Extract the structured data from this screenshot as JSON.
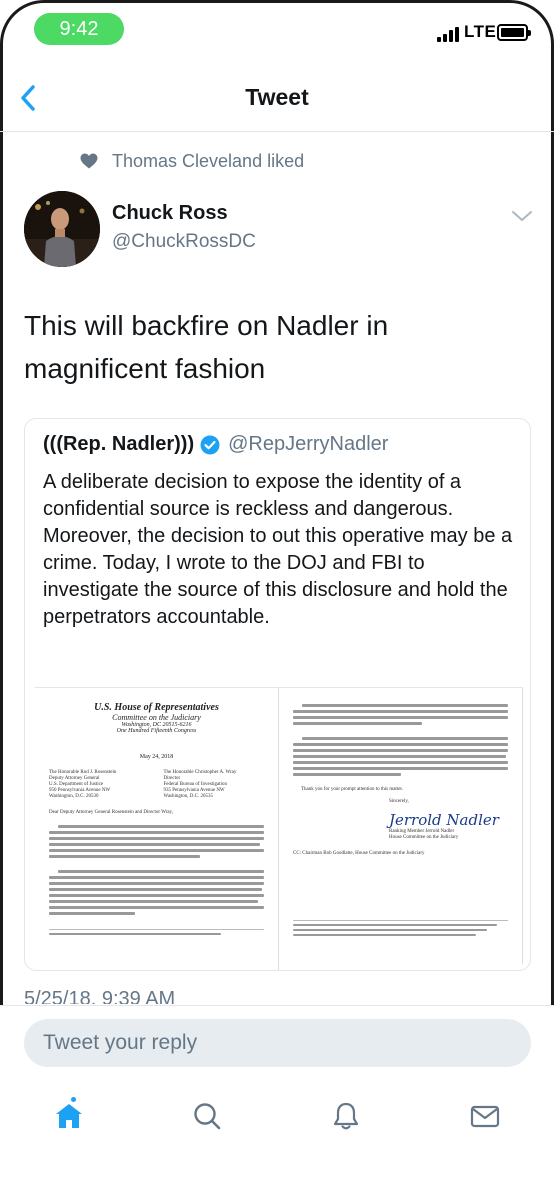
{
  "status_bar": {
    "time": "9:42",
    "network": "LTE"
  },
  "nav": {
    "title": "Tweet",
    "back_icon": "chevron-left-icon"
  },
  "social_context": {
    "icon": "heart-icon",
    "text": "Thomas Cleveland liked"
  },
  "tweet": {
    "display_name": "Chuck Ross",
    "handle": "@ChuckRossDC",
    "text": "This will backfire on Nadler in magnificent fashion",
    "timestamp": "5/25/18, 9:39 AM"
  },
  "quoted_tweet": {
    "display_name": "(((Rep. Nadler)))",
    "verified": true,
    "handle": "@RepJerryNadler",
    "text": "A deliberate decision to expose the identity of a confidential source is reckless and dangerous. Moreover, the decision to out this operative may be a crime. Today, I wrote to the DOJ and FBI to investigate the source of this disclosure and hold the perpetrators accountable.",
    "attachment": {
      "page1": {
        "letterhead_1": "U.S. House of Representatives",
        "letterhead_2": "Committee on the Judiciary",
        "letterhead_3": "Washington, DC 20515-6216",
        "letterhead_4": "One Hundred Fifteenth Congress",
        "date": "May 24, 2018",
        "addr_left": [
          "The Honorable Rod J. Rosenstein",
          "Deputy Attorney General",
          "U.S. Department of Justice",
          "950 Pennsylvania Avenue NW",
          "Washington, D.C. 20530"
        ],
        "addr_right": [
          "The Honorable Christopher A. Wray",
          "Director",
          "Federal Bureau of Investigation",
          "935 Pennsylvania Avenue NW",
          "Washington, D.C. 20535"
        ],
        "salutation": "Dear Deputy Attorney General Rosenstein and Director Wray,"
      },
      "page2": {
        "closing": "Thank you for your prompt attention to this matter.",
        "sincerely": "Sincerely,",
        "signer_title_1": "Ranking Member Jerrold Nadler",
        "signer_title_2": "House Committee on the Judiciary",
        "cc": "CC:    Chairman Bob Goodlatte, House Committee on the Judiciary"
      }
    }
  },
  "reply": {
    "placeholder": "Tweet your reply"
  },
  "tabs": [
    {
      "name": "home",
      "icon": "home-icon",
      "active": true
    },
    {
      "name": "search",
      "icon": "search-icon",
      "active": false
    },
    {
      "name": "notifications",
      "icon": "bell-icon",
      "active": false
    },
    {
      "name": "messages",
      "icon": "envelope-icon",
      "active": false
    }
  ],
  "colors": {
    "accent": "#1da1f2",
    "status_pill": "#4cd964",
    "secondary_text": "#657786",
    "primary_text": "#14171a"
  }
}
